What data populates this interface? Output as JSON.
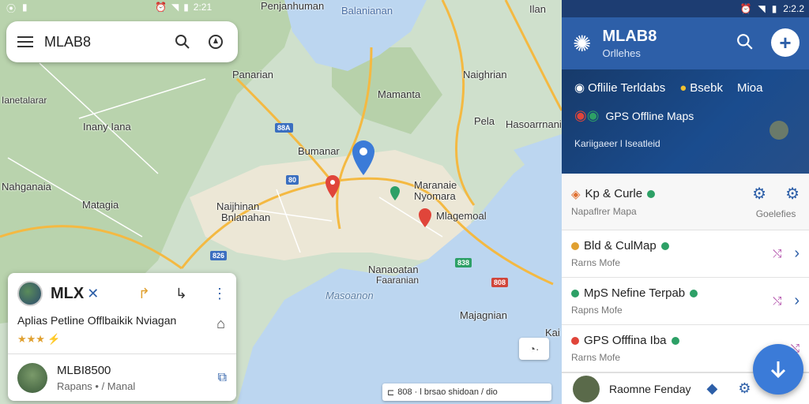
{
  "status_bar": {
    "left_icons": [
      "gps-icon",
      "signal-icon"
    ],
    "time_left": "2:21",
    "time_right": "2:2"
  },
  "search": {
    "query": "MLAB8"
  },
  "map_labels": [
    {
      "id": "penjanhuman",
      "text": "Penjanhuman"
    },
    {
      "id": "balanian-top",
      "text": "Balanianan"
    },
    {
      "id": "ilan",
      "text": "Ilan"
    },
    {
      "id": "panarian",
      "text": "Panarian"
    },
    {
      "id": "naighrian",
      "text": "Naighrian"
    },
    {
      "id": "janetana",
      "text": "Ianetalarar"
    },
    {
      "id": "mamanta",
      "text": "Mamanta"
    },
    {
      "id": "inany",
      "text": "Inany Iana"
    },
    {
      "id": "pela",
      "text": "Pela"
    },
    {
      "id": "hasoaman",
      "text": "Hasoarrnanian"
    },
    {
      "id": "bumanar",
      "text": "Bumanar"
    },
    {
      "id": "nahgania",
      "text": "Nahganaia"
    },
    {
      "id": "manaraie",
      "text": "Maranaie"
    },
    {
      "id": "myomara",
      "text": "Nyomara"
    },
    {
      "id": "matagia",
      "text": "Matagia"
    },
    {
      "id": "naijhinan",
      "text": "Naijhinan"
    },
    {
      "id": "bnlanahan",
      "text": "Bnlanahan"
    },
    {
      "id": "mlagemoal",
      "text": "Mlagemoal"
    },
    {
      "id": "nanaoatan",
      "text": "Nanaoatan"
    },
    {
      "id": "faaranian",
      "text": "Faaranian"
    },
    {
      "id": "masoanon",
      "text": "Masoanon"
    },
    {
      "id": "majagnian",
      "text": "Majagnian"
    },
    {
      "id": "kai",
      "text": "Kai"
    }
  ],
  "road_shields": [
    "88A",
    "80",
    "826",
    "838",
    "808"
  ],
  "place_card": {
    "name": "MLX",
    "description": "Aplias Petline Offlbaikik Nviagan",
    "rating": "★★★",
    "bottom_title": "MLBI8500",
    "bottom_sub": "Rapans • / Manal"
  },
  "attribution": "808 · l brsao shidoan / dio",
  "panel": {
    "status_time": "2:2.2",
    "app_title": "MLAB8",
    "app_subtitle": "Orllehes",
    "banner_tabs": [
      "Oflilie Terldabs",
      "Bsebk",
      "Mioa"
    ],
    "banner_app": "GPS Offline Maps",
    "banner_footer": "Kariigaeer l Iseatleid",
    "items": [
      {
        "title": "Kp & Curle",
        "subtitle": "Napaflrer Mapa",
        "action_label": "Goelefies",
        "color": "#2da066"
      },
      {
        "title": "Bld & CulMap",
        "subtitle": "Rarns Mofe",
        "color": "#2aa84a"
      },
      {
        "title": "MpS Nefine Terpab",
        "subtitle": "Rapns Mofe",
        "color": "#2da066"
      },
      {
        "title": "GPS Offfina Iba",
        "subtitle": "Rarns Mofe",
        "color": "#2aa84a"
      }
    ],
    "bottom_label": "Raomne Fenday"
  },
  "colors": {
    "header_blue": "#2d5fa8",
    "dark_blue": "#1d3d72",
    "fab_blue": "#3b7bd8",
    "water": "#bcd6f0",
    "land": "#e8eadf",
    "road": "#f4b942"
  }
}
